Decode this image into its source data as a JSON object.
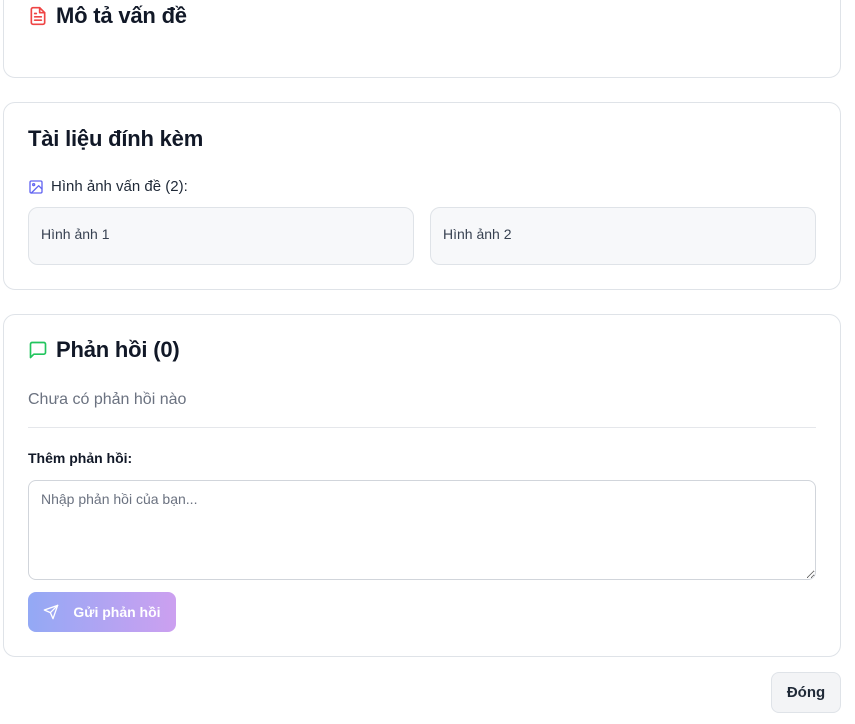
{
  "description_section": {
    "title": "Mô tả vấn đề",
    "icon": "document-icon",
    "icon_color": "#ef4444"
  },
  "attachments_section": {
    "title": "Tài liệu đính kèm",
    "images_label": "Hình ảnh vấn đề (2):",
    "images_icon": "image-icon",
    "images_icon_color": "#6366f1",
    "images": [
      {
        "label": "Hình ảnh 1"
      },
      {
        "label": "Hình ảnh 2"
      }
    ]
  },
  "reply_section": {
    "title": "Phản hồi (0)",
    "icon": "message-icon",
    "icon_color": "#22c55e",
    "empty_text": "Chưa có phản hồi nào",
    "add_label": "Thêm phản hồi:",
    "input_placeholder": "Nhập phản hồi của bạn...",
    "input_value": "",
    "send_label": "Gửi phản hồi",
    "send_icon": "send-icon"
  },
  "footer": {
    "close_label": "Đóng"
  }
}
